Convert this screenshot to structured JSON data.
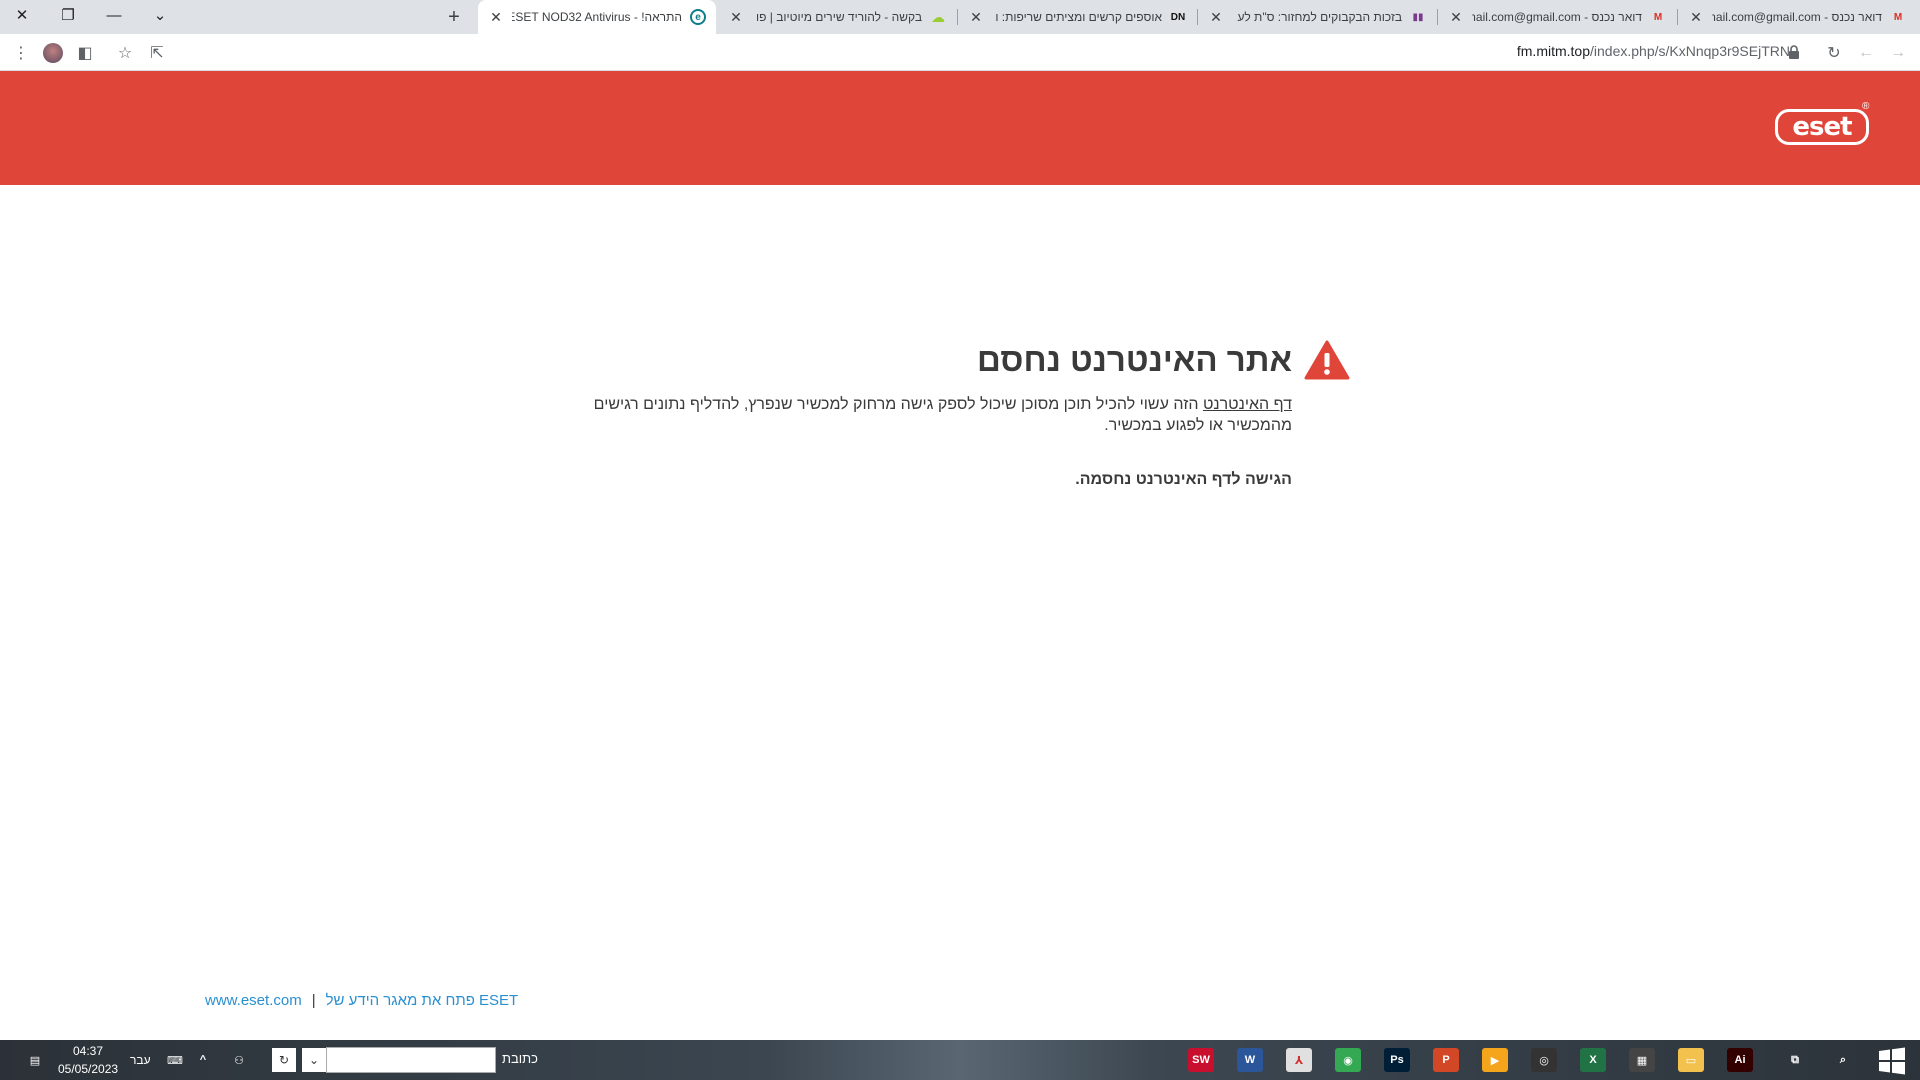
{
  "window": {
    "close_glyph": "✕",
    "restore_glyph": "❐",
    "minimize_glyph": "—",
    "tab_search_glyph": "⌄",
    "new_tab_glyph": "+"
  },
  "tabs": [
    {
      "title": "התראה! - ESET NOD32 Antivirus",
      "icon": "e",
      "icon_color": "#0f7c8a",
      "active": true
    },
    {
      "title": "בקשה - להוריד שירים מיוטיוב | פו",
      "icon": "☁",
      "icon_color": "#9acd32",
      "active": false
    },
    {
      "title": "אוספים קרשים ומציתים שריפות: ו",
      "icon": "DN",
      "icon_color": "#111111",
      "active": false
    },
    {
      "title": "בזכות הבקבוקים למחזור: ס\"ת לע",
      "icon": "▮▮",
      "icon_color": "#7a3a8c",
      "active": false
    },
    {
      "title": "דואר נכנס - Gmail.com@gmail.com",
      "icon": "M",
      "icon_color": "#d93025",
      "active": false
    },
    {
      "title": "דואר נכנס - Gmail.com@gmail.com",
      "icon": "M",
      "icon_color": "#d93025",
      "active": false
    }
  ],
  "toolbar": {
    "url_host": "fm.mitm.top",
    "url_path": "/index.php/s/KxNnqp3r9SEjTRN"
  },
  "header": {
    "logo_text": "eset",
    "logo_reg": "®"
  },
  "page": {
    "title": "אתר האינטרנט נחסם",
    "desc_link": "דף האינטרנט",
    "desc_rest": " הזה עשוי להכיל תוכן מסוכן שיכול לספק גישה מרחוק למכשיר שנפרץ, להדליף נתונים רגישים מהמכשיר או לפגוע במכשיר.",
    "blocked_text": "הגישה לדף האינטרנט נחסמה."
  },
  "footer": {
    "site_link": "www.eset.com",
    "separator": "|",
    "kb_link": "פתח את מאגר הידע של ESET"
  },
  "taskbar": {
    "time": "04:37",
    "date": "05/05/2023",
    "language": "עבר",
    "address_label": "כתובת",
    "apps": [
      {
        "name": "solidworks",
        "label": "SW",
        "color": "#c8102e"
      },
      {
        "name": "word",
        "label": "W",
        "color": "#2b579a"
      },
      {
        "name": "acrobat",
        "label": "⅄",
        "color": "#e0e0e0"
      },
      {
        "name": "chrome",
        "label": "◉",
        "color": "#34a853"
      },
      {
        "name": "photoshop",
        "label": "Ps",
        "color": "#001e36"
      },
      {
        "name": "powerpoint",
        "label": "P",
        "color": "#d24726"
      },
      {
        "name": "media-player",
        "label": "▶",
        "color": "#f4a51c"
      },
      {
        "name": "app-2021",
        "label": "◎",
        "color": "#333333"
      },
      {
        "name": "excel",
        "label": "X",
        "color": "#217346"
      },
      {
        "name": "calculator",
        "label": "▦",
        "color": "#444444"
      },
      {
        "name": "file-explorer",
        "label": "▭",
        "color": "#f2c14e"
      },
      {
        "name": "illustrator",
        "label": "Ai",
        "color": "#330000"
      }
    ]
  }
}
